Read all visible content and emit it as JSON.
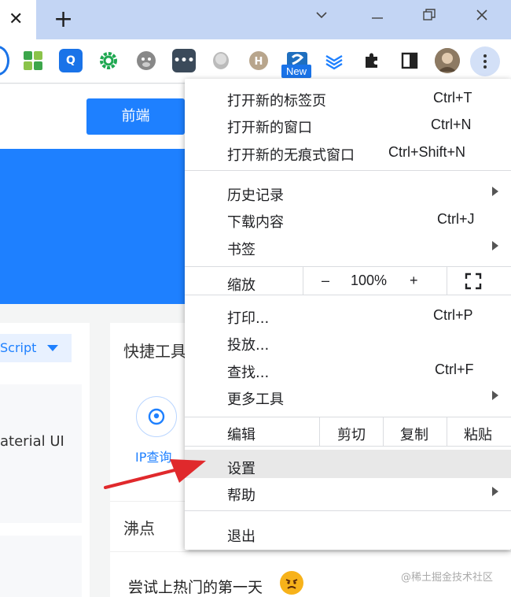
{
  "browser": {
    "tab_close": "✕",
    "new_tab": "+",
    "win_minimize": "⌄",
    "win_restore": "❐",
    "win_close": "✕",
    "new_badge": "New"
  },
  "page": {
    "frontend_button": "前端",
    "script_select": "Script",
    "left_item_text": "aterial UI",
    "quick_tools_title": "快捷工具",
    "ip_lookup_label": "IP查询",
    "feidian_title": "沸点",
    "post_text": "尝试上热门的第一天",
    "watermark": "@稀土掘金技术社区"
  },
  "menu": {
    "new_tab": {
      "label": "打开新的标签页",
      "shortcut": "Ctrl+T"
    },
    "new_window": {
      "label": "打开新的窗口",
      "shortcut": "Ctrl+N"
    },
    "new_incognito": {
      "label": "打开新的无痕式窗口",
      "shortcut": "Ctrl+Shift+N"
    },
    "history": {
      "label": "历史记录"
    },
    "downloads": {
      "label": "下载内容",
      "shortcut": "Ctrl+J"
    },
    "bookmarks": {
      "label": "书签"
    },
    "zoom": {
      "label": "缩放",
      "minus": "–",
      "value": "100%",
      "plus": "+"
    },
    "print": {
      "label": "打印...",
      "shortcut": "Ctrl+P"
    },
    "cast": {
      "label": "投放..."
    },
    "find": {
      "label": "查找...",
      "shortcut": "Ctrl+F"
    },
    "more_tools": {
      "label": "更多工具"
    },
    "edit": {
      "label": "编辑",
      "cut": "剪切",
      "copy": "复制",
      "paste": "粘贴"
    },
    "settings": {
      "label": "设置"
    },
    "help": {
      "label": "帮助"
    },
    "exit": {
      "label": "退出"
    }
  },
  "icons": [
    "close-icon",
    "plus-icon",
    "chevron-down-icon",
    "restore-icon",
    "window-close-icon",
    "extension-icons",
    "puzzle-icon",
    "sidepanel-icon",
    "avatar",
    "kebab-menu-icon",
    "fullscreen-icon",
    "location-icon",
    "angry-emoji-icon",
    "red-arrow"
  ],
  "colors": {
    "accent": "#1e80ff",
    "tabstrip": "#c3d5f4",
    "menu_highlight": "#e8e8e8",
    "arrow": "#e0292c"
  }
}
